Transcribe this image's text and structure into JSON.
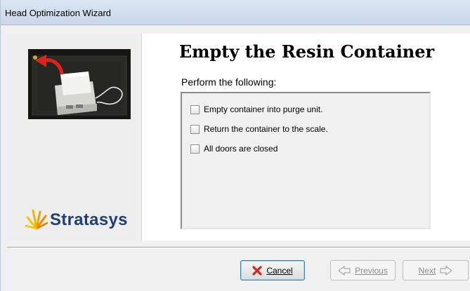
{
  "window": {
    "title": "Head Optimization Wizard"
  },
  "sidebar": {
    "image": "resin-container-on-scale-photo",
    "logo_text": "Stratasys"
  },
  "page": {
    "title": "Empty the Resin Container",
    "instruction": "Perform the following:",
    "checklist": [
      {
        "label": "Empty container into purge unit.",
        "checked": false
      },
      {
        "label": "Return the container to the scale.",
        "checked": false
      },
      {
        "label": "All doors are closed",
        "checked": false
      }
    ]
  },
  "buttons": {
    "cancel": {
      "label": "Cancel",
      "icon": "red-x-icon",
      "enabled": true
    },
    "previous": {
      "label": "Previous",
      "icon": "arrow-left-icon",
      "enabled": false
    },
    "next": {
      "label": "Next",
      "icon": "arrow-right-icon",
      "enabled": false
    }
  },
  "colors": {
    "titlebar": "#c7d7ea",
    "logo_text": "#1f3f7a",
    "cancel_icon": "#d4271d",
    "arrow_red": "#e0231a"
  }
}
